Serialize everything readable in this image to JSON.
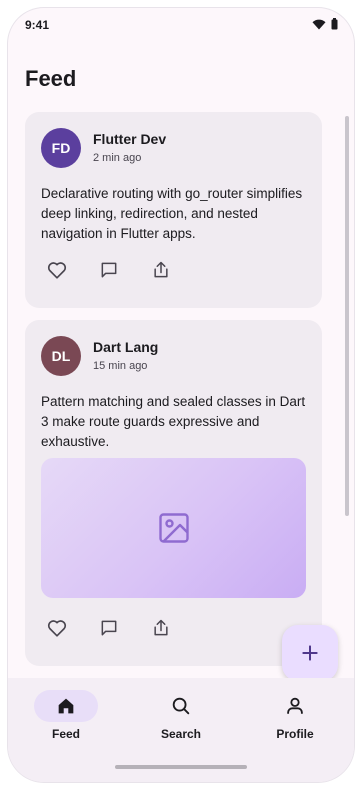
{
  "status_bar": {
    "time": "9:41"
  },
  "header": {
    "title": "Feed"
  },
  "posts": [
    {
      "initials": "FD",
      "author": "Flutter Dev",
      "time": "2 min ago",
      "text": "Declarative routing with go_router simplifies deep linking, redirection, and nested navigation in Flutter apps.",
      "avatar_color": "#5b3f9e",
      "has_image": false
    },
    {
      "initials": "DL",
      "author": "Dart Lang",
      "time": "15 min ago",
      "text": "Pattern matching and sealed classes in Dart 3 make route guards expressive and exhaustive.",
      "avatar_color": "#7a4854",
      "has_image": true
    }
  ],
  "bottom_nav": {
    "items": [
      {
        "label": "Feed",
        "icon": "home-icon",
        "selected": true
      },
      {
        "label": "Search",
        "icon": "search-icon",
        "selected": false
      },
      {
        "label": "Profile",
        "icon": "person-icon",
        "selected": false
      }
    ]
  },
  "colors": {
    "background": "#fdf7fb",
    "card": "#f0ebf1",
    "accent": "#6750a4",
    "nav_selected": "#e8def8",
    "fab": "#eaddff"
  }
}
